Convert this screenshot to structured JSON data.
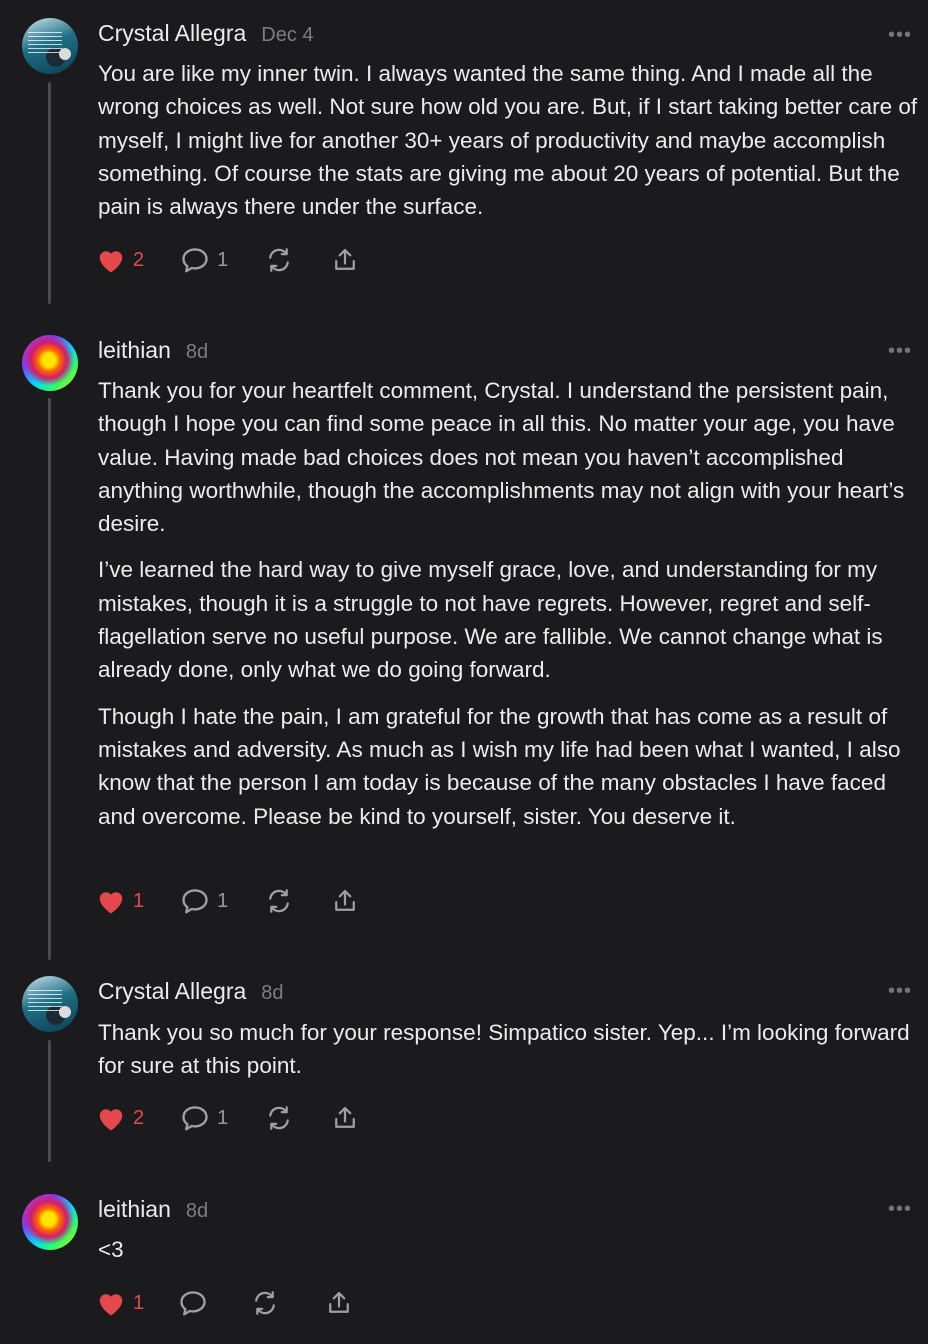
{
  "comments": [
    {
      "author": "Crystal Allegra",
      "date": "Dec 4",
      "avatar": "crystal-avatar",
      "paragraphs": [
        "You are like my inner twin. I always wanted the same thing. And I made all the wrong choices as well. Not sure how old you are. But, if I start taking better care of myself, I might live for another 30+ years of productivity and maybe accomplish something. Of course the stats are giving me about 20 years of potential. But the pain is always there under the surface."
      ],
      "likes": "2",
      "replies": "1"
    },
    {
      "author": "leithian",
      "date": "8d",
      "avatar": "leithian-avatar",
      "paragraphs": [
        "Thank you for your heartfelt comment, Crystal. I understand the persistent pain, though I hope you can find some peace in all this. No matter your age, you have value. Having made bad choices does not mean you haven’t accomplished anything worthwhile, though the accomplishments may not align with your heart’s desire.",
        "I’ve learned the hard way to give myself grace, love, and understanding for my mistakes, though it is a struggle to not have regrets. However, regret and self-flagellation serve no useful purpose. We are fallible. We cannot change what is already done, only what we do going forward.",
        "Though I hate the pain, I am grateful for the growth that has come as a result of mistakes and adversity. As much as I wish my life had been what I wanted, I also know that the person I am today is because of the many obstacles I have faced and overcome. Please be kind to yourself, sister. You deserve it."
      ],
      "likes": "1",
      "replies": "1"
    },
    {
      "author": "Crystal Allegra",
      "date": "8d",
      "avatar": "crystal-avatar",
      "paragraphs": [
        "Thank you so much for your response! Simpatico sister. Yep... I’m looking forward for sure at this point."
      ],
      "likes": "2",
      "replies": "1"
    },
    {
      "author": "leithian",
      "date": "8d",
      "avatar": "leithian-avatar",
      "paragraphs": [
        "<3"
      ],
      "likes": "1",
      "replies": ""
    }
  ],
  "more_label": "•••",
  "colors": {
    "background": "#1b1b1d",
    "text": "#ececec",
    "muted": "#7e7e82",
    "heart": "#e5484d",
    "thread_line": "#4a4a4d"
  },
  "icons": [
    "heart-icon",
    "comment-icon",
    "restack-icon",
    "share-icon",
    "more-icon"
  ]
}
